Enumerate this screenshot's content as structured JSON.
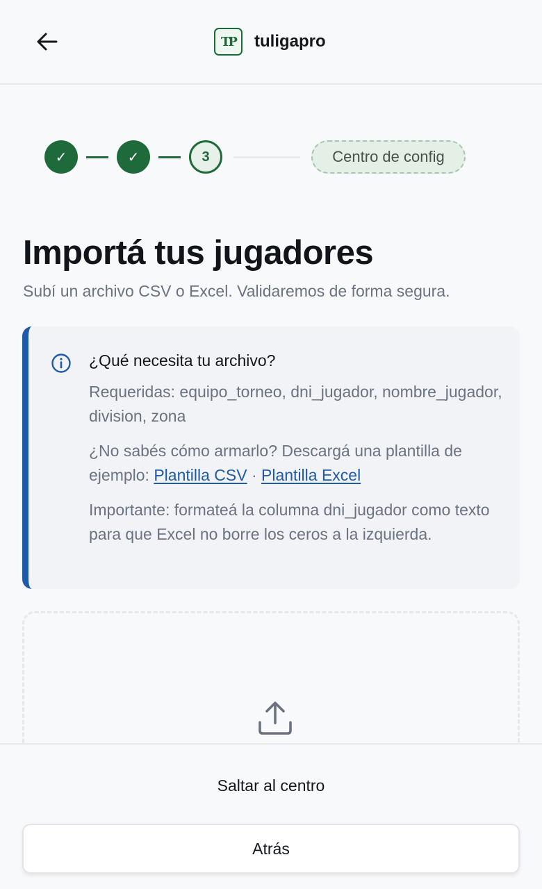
{
  "header": {
    "back_icon": "arrow-left-icon",
    "logo_text": "TP",
    "brand_name": "tuligapro"
  },
  "stepper": {
    "steps": [
      {
        "state": "done",
        "label": "✓"
      },
      {
        "state": "done",
        "label": "✓"
      },
      {
        "state": "current",
        "label": "3"
      }
    ],
    "next_badge": "Centro de config",
    "colors": {
      "done": "#1f6a3b",
      "badge_bg": "#e4efe6"
    }
  },
  "main": {
    "title": "Importá tus jugadores",
    "subtitle": "Subí un archivo CSV o Excel. Validaremos de forma segura."
  },
  "info": {
    "icon": "info-icon",
    "title": "¿Qué necesita tu archivo?",
    "required": "Requeridas: equipo_torneo, dni_jugador, nombre_jugador, division, zona",
    "template_prefix": "¿No sabés cómo armarlo? Descargá una plantilla de ejemplo: ",
    "template_csv": "Plantilla CSV",
    "template_sep": " · ",
    "template_excel": "Plantilla Excel",
    "important": "Importante: formateá la columna dni_jugador como texto para que Excel no borre los ceros a la izquierda.",
    "accent_color": "#1f5aa8"
  },
  "dropzone": {
    "icon": "upload-icon"
  },
  "footer": {
    "skip_label": "Saltar al centro",
    "back_label": "Atrás"
  }
}
